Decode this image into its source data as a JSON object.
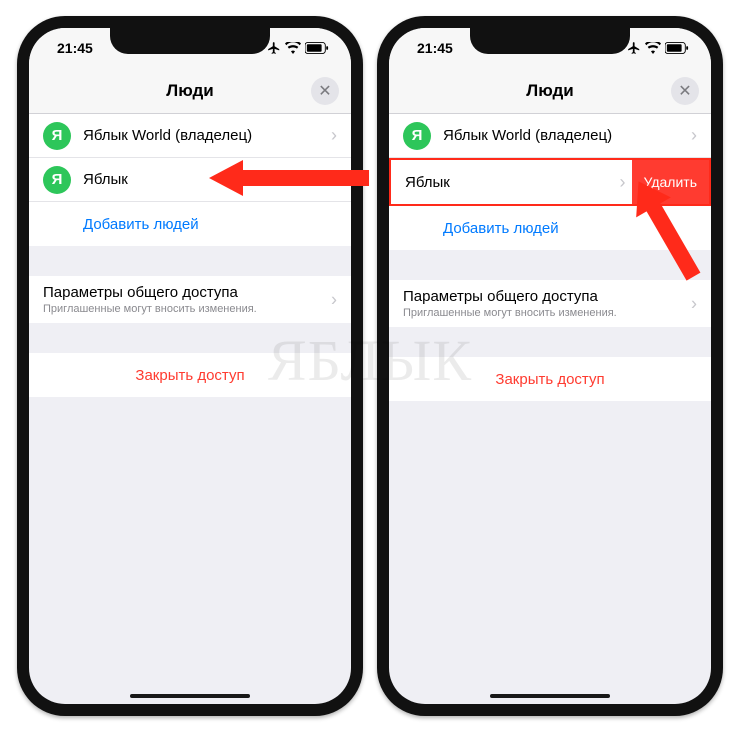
{
  "status": {
    "time": "21:45"
  },
  "nav": {
    "title": "Люди",
    "close": "✕"
  },
  "people": {
    "owner_avatar": "Я",
    "owner_name": "Яблык World (владелец)",
    "member_avatar": "Я",
    "member_name": "Яблык",
    "add": "Добавить людей",
    "delete": "Удалить"
  },
  "settings": {
    "title": "Параметры общего доступа",
    "subtitle": "Приглашенные могут вносить изменения."
  },
  "close_access": "Закрыть доступ",
  "watermark": "ЯБЛЫК",
  "icons": {
    "chevron": "›"
  }
}
